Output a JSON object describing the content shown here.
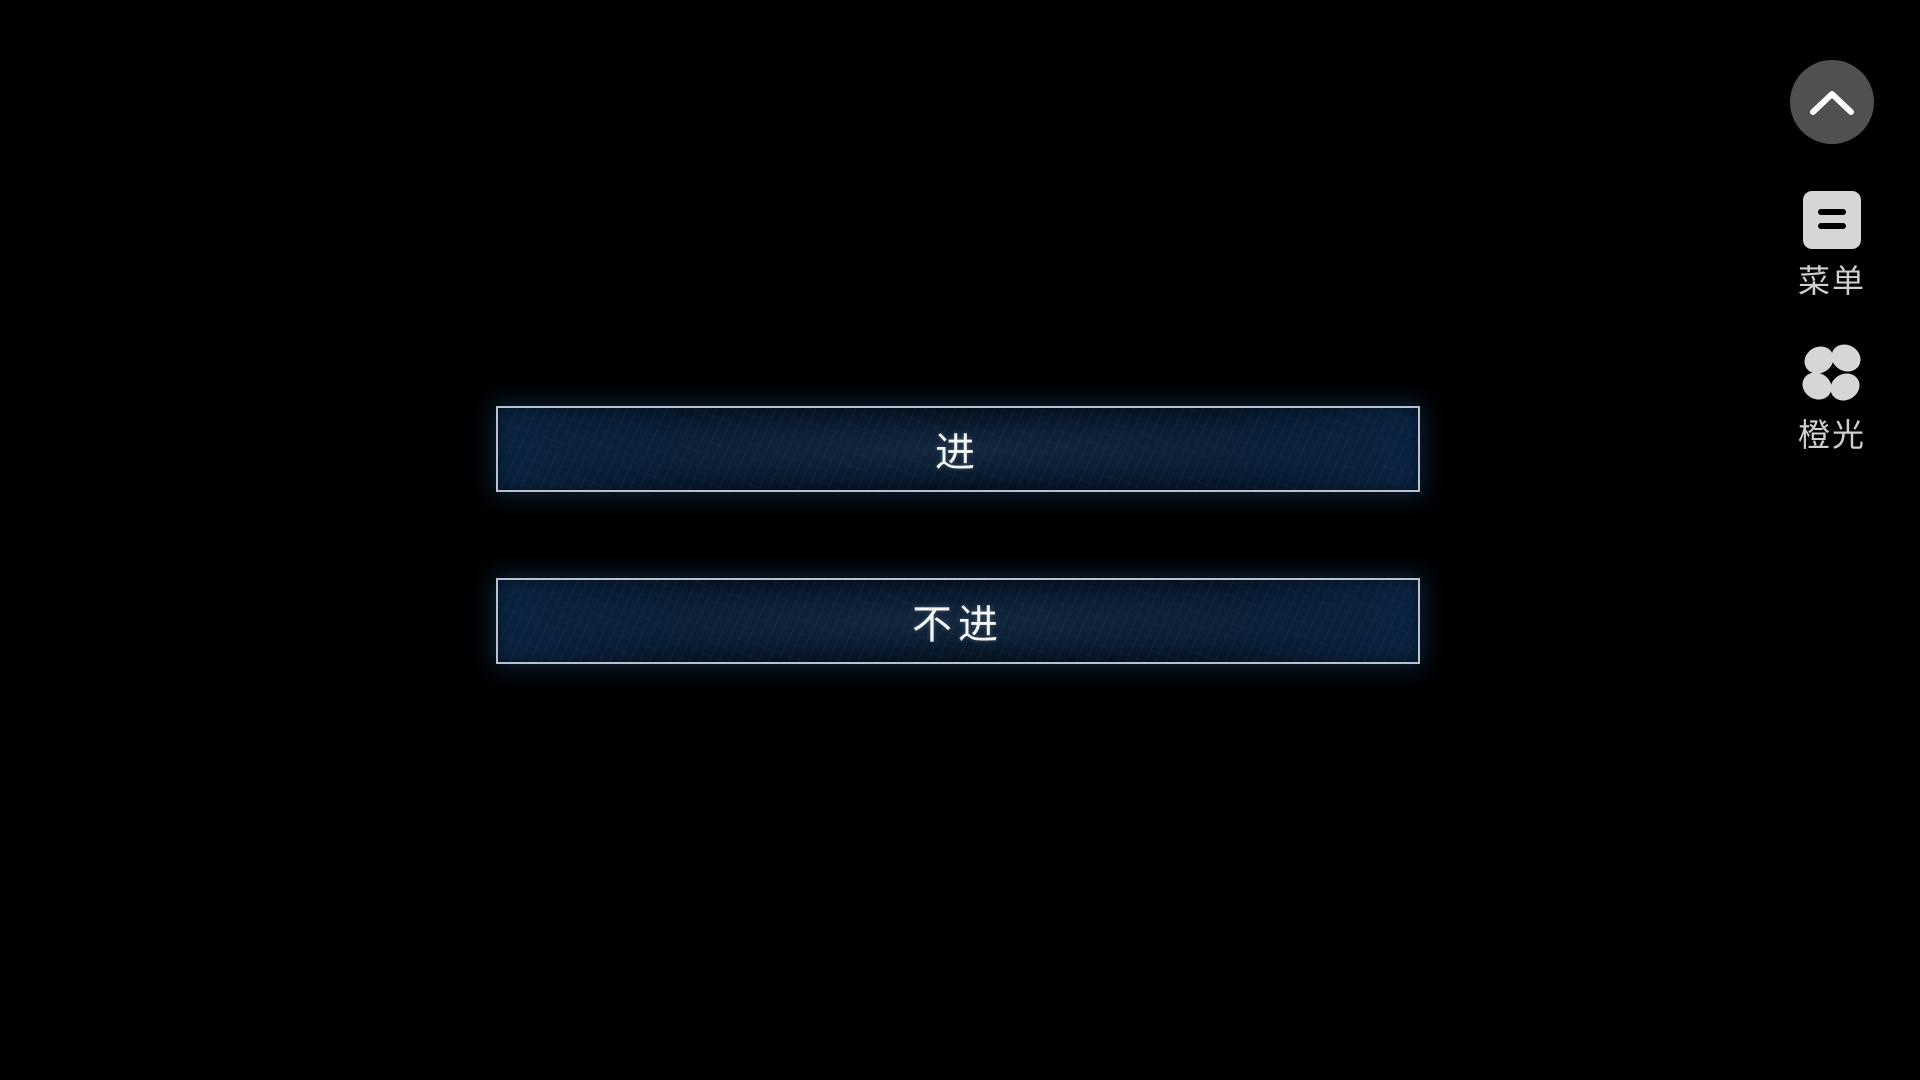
{
  "choices": [
    {
      "label": "进"
    },
    {
      "label": "不进"
    }
  ],
  "side_bar": {
    "collapse_icon": "chevron-up-icon",
    "items": [
      {
        "label": "菜单",
        "icon": "clipboard-menu-icon"
      },
      {
        "label": "橙光",
        "icon": "petal-logo-icon"
      }
    ]
  },
  "colors": {
    "background": "#000000",
    "choice_fill": "#081a31",
    "choice_border": "#b8c2cc",
    "side_button": "#505050",
    "side_text": "#cfcfcf"
  }
}
